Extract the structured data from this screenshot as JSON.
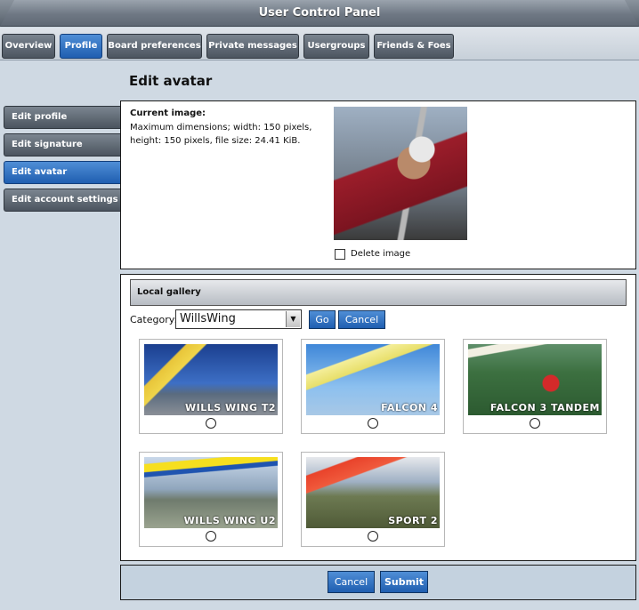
{
  "header": {
    "title": "User Control Panel"
  },
  "tabs": [
    {
      "label": "Overview"
    },
    {
      "label": "Profile"
    },
    {
      "label": "Board preferences"
    },
    {
      "label": "Private messages"
    },
    {
      "label": "Usergroups"
    },
    {
      "label": "Friends & Foes"
    }
  ],
  "active_tab": "Profile",
  "sidebar": {
    "items": [
      {
        "label": "Edit profile"
      },
      {
        "label": "Edit signature"
      },
      {
        "label": "Edit avatar"
      },
      {
        "label": "Edit account settings"
      }
    ],
    "active": "Edit avatar"
  },
  "main": {
    "title": "Edit avatar",
    "current_image": {
      "label": "Current image:",
      "description": "Maximum dimensions; width: 150 pixels, height: 150 pixels, file size: 24.41 KiB.",
      "delete_label": "Delete image"
    },
    "gallery": {
      "heading": "Local gallery",
      "category_label": "Category:",
      "category_value": "WillsWing",
      "go_label": "Go",
      "cancel_label": "Cancel",
      "items": [
        {
          "caption": "WILLS WING T2"
        },
        {
          "caption": "FALCON 4"
        },
        {
          "caption": "FALCON 3 TANDEM"
        },
        {
          "caption": "WILLS WING U2"
        },
        {
          "caption": "SPORT 2"
        }
      ]
    },
    "footer": {
      "cancel_label": "Cancel",
      "submit_label": "Submit"
    }
  },
  "colors": {
    "accent_blue": "#2f6fc4",
    "tab_gray": "#5e6873",
    "page_bg": "#cfd9e3"
  }
}
